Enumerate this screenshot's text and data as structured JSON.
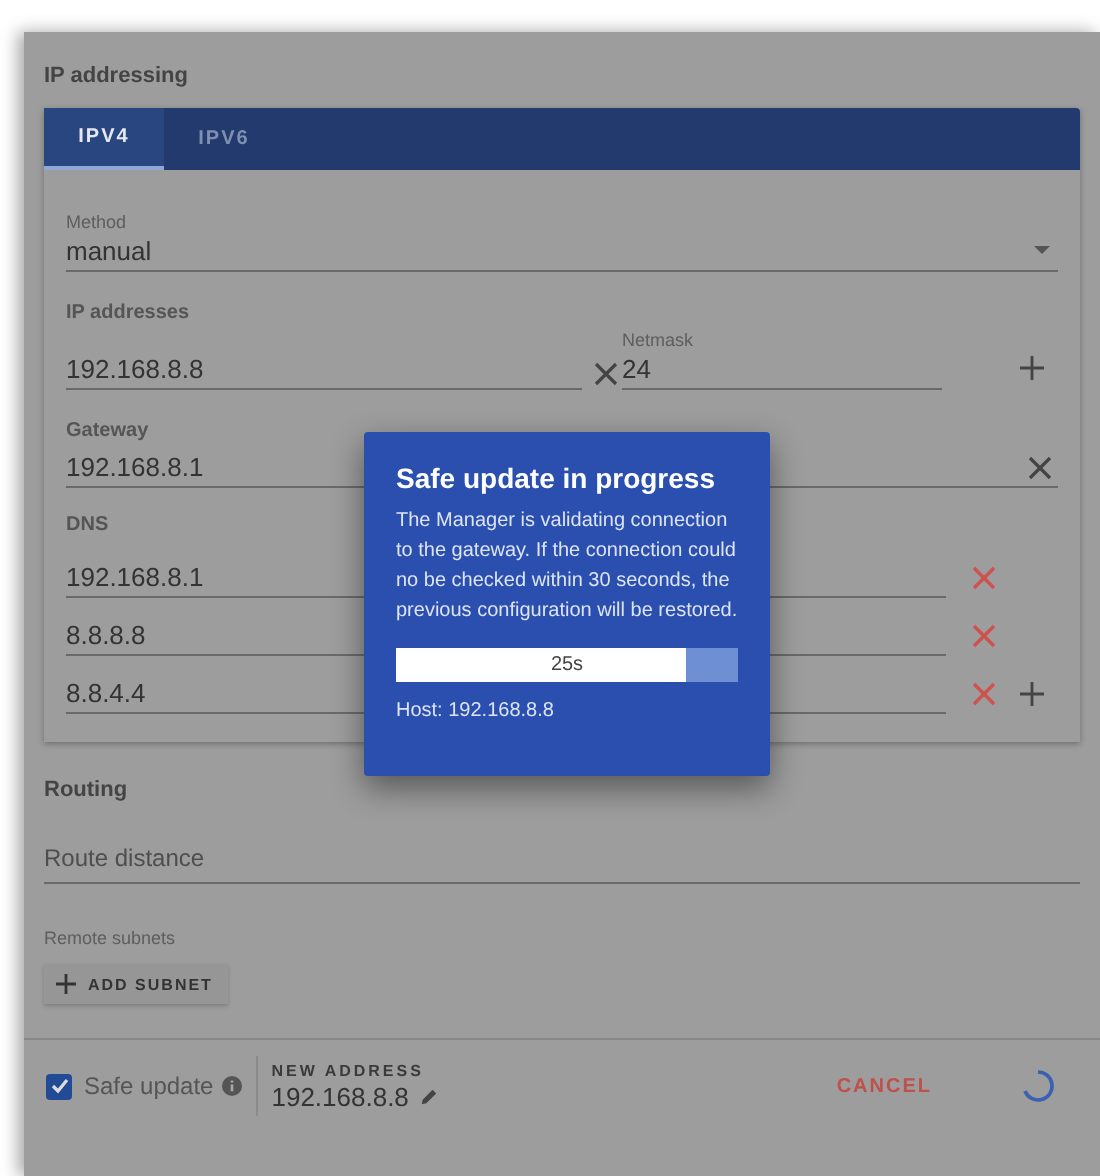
{
  "section_title": "IP addressing",
  "tabs": [
    {
      "label": "IPV4",
      "selected": true
    },
    {
      "label": "IPV6",
      "selected": false
    }
  ],
  "method": {
    "label": "Method",
    "value": "manual"
  },
  "ip_addresses": {
    "label": "IP addresses",
    "rows": [
      {
        "address": "192.168.8.8",
        "netmask_label": "Netmask",
        "netmask": "24"
      }
    ]
  },
  "gateway": {
    "label": "Gateway",
    "value": "192.168.8.1"
  },
  "dns": {
    "label": "DNS",
    "servers": [
      "192.168.8.1",
      "8.8.8.8",
      "8.8.4.4"
    ]
  },
  "routing": {
    "title": "Routing",
    "route_distance": {
      "placeholder": "Route distance"
    },
    "remote_subnets_label": "Remote subnets",
    "add_button": "ADD SUBNET"
  },
  "footer": {
    "safe_update": {
      "label": "Safe update",
      "checked": true
    },
    "new_address": {
      "label": "NEW ADDRESS",
      "value": "192.168.8.8"
    },
    "cancel": "CANCEL"
  },
  "dialog": {
    "title": "Safe update in progress",
    "message": "The Manager is validating connection to the gateway. If the connection could no be checked within 30 seconds, the previous configuration will be restored.",
    "progress": {
      "level": 0.85,
      "reading": "25s"
    },
    "host": "Host: 192.168.8.8"
  }
}
